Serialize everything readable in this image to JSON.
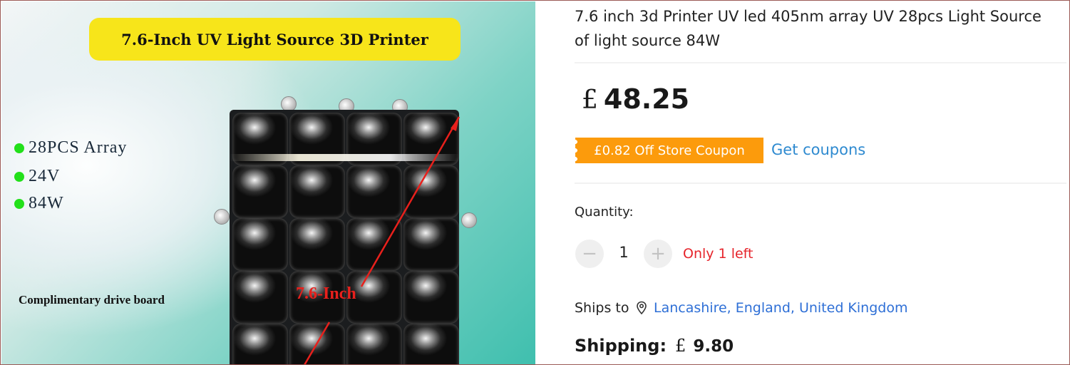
{
  "image": {
    "banner": "7.6-Inch UV Light Source 3D Printer",
    "specs": [
      "28PCS Array",
      "24V",
      "84W"
    ],
    "board_caption": "Complimentary drive board",
    "measure_label": "7.6-Inch"
  },
  "product": {
    "title_line1": "7.6 inch 3d Printer UV led 405nm array UV 28pcs Light Source",
    "title_line2": "of light source 84W",
    "price_currency": "£",
    "price_amount": "48.25",
    "coupon_text": "£0.82 Off Store Coupon",
    "get_coupons": "Get coupons",
    "quantity_label": "Quantity:",
    "quantity_value": "1",
    "minus_symbol": "−",
    "plus_symbol": "+",
    "stock_text": "Only 1 left",
    "ships_to_label": "Ships to",
    "ships_to_location": "Lancashire, England, United Kingdom",
    "shipping_label": "Shipping:",
    "shipping_currency": "£",
    "shipping_amount": "9.80"
  },
  "colors": {
    "coupon": "#fc9b0c",
    "link": "#2e8ad0",
    "location_link": "#2e6fd6",
    "stock_warning": "#e6242b",
    "banner": "#f7e51a"
  },
  "icons": [
    "location-pin-icon"
  ]
}
